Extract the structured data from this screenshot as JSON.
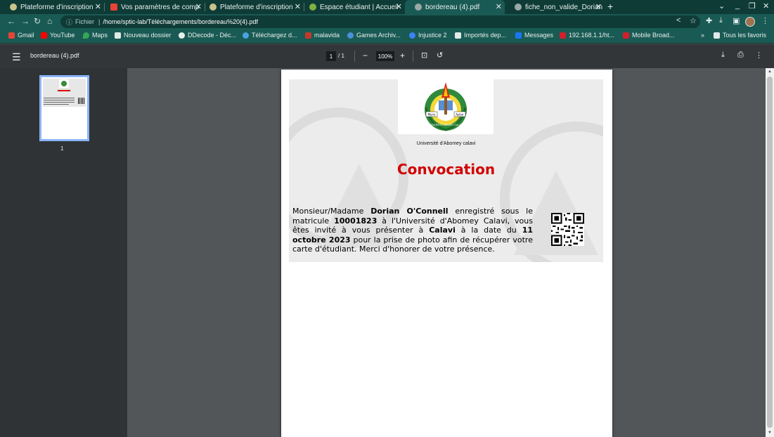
{
  "browser": {
    "tabs": [
      {
        "title": "Plateforme d'inscription",
        "active": false
      },
      {
        "title": "Vos paramètres de comp",
        "active": false
      },
      {
        "title": "Plateforme d'inscription",
        "active": false
      },
      {
        "title": "Espace étudiant | Accueil",
        "active": false
      },
      {
        "title": "bordereau (4).pdf",
        "active": true
      },
      {
        "title": "fiche_non_valide_Dorian",
        "active": false
      }
    ],
    "new_tab_icon": "plus-icon",
    "window_controls": [
      "chevron-down-icon",
      "minimize-icon",
      "restore-icon",
      "close-icon"
    ],
    "address": {
      "info_icon": "info-icon",
      "scheme_label": "Fichier",
      "url": "/home/sptic-lab/Téléchargements/bordereau%20(4).pdf"
    },
    "bookmarks": [
      {
        "label": "Gmail",
        "color": "#ea4335"
      },
      {
        "label": "YouTube",
        "color": "#ff0000"
      },
      {
        "label": "Maps",
        "color": "#34a853"
      },
      {
        "label": "Nouveau dossier",
        "color": "#e8f0ee"
      },
      {
        "label": "DDecode - Déc...",
        "color": "#e8f0ee"
      },
      {
        "label": "Téléchargez d...",
        "color": "#4aa3df"
      },
      {
        "label": "malavida",
        "color": "#c0392b"
      },
      {
        "label": "Games Archiv...",
        "color": "#4a90d9"
      },
      {
        "label": "Injustice 2",
        "color": "#3b82f6"
      },
      {
        "label": "Importés dep...",
        "color": "#e8f0ee"
      },
      {
        "label": "Messages",
        "color": "#1877f2"
      },
      {
        "label": "192.168.1.1/ht...",
        "color": "#d11f2b"
      },
      {
        "label": "Mobile Broad...",
        "color": "#d11f2b"
      }
    ],
    "bookmarks_overflow": "»",
    "all_bookmarks": "Tous les favoris"
  },
  "pdf_viewer": {
    "file_name": "bordereau (4).pdf",
    "current_page": "1",
    "total_pages": "/ 1",
    "zoom": "100%",
    "thumbnail_label": "1"
  },
  "document": {
    "university": "Université d'Abomey calavi",
    "title": "Convocation",
    "body": {
      "intro": "Monsieur/Madame",
      "name": "Dorian O'Connell",
      "part2": "enregistré sous le matricule",
      "matricule": "10001823",
      "part3": "à l'Université d'Abomey Calavi, vous êtes invité à vous présenter à",
      "place": "Calavi",
      "part4": "à la date du",
      "date": "11 octobre 2023",
      "part5": "pour la prise de photo afin de récupérer votre carte d'étudiant. Merci d'honorer de votre présence."
    },
    "logo_texts": {
      "left": "Meris",
      "right": "Ayitor",
      "ring": "UNIVERSITÉ ABOMEY-CALAVI"
    }
  },
  "colors": {
    "tab_bar": "#0f3b37",
    "toolbar": "#1a5a54",
    "title_red": "#d30000",
    "pdf_toolbar": "#323639"
  }
}
